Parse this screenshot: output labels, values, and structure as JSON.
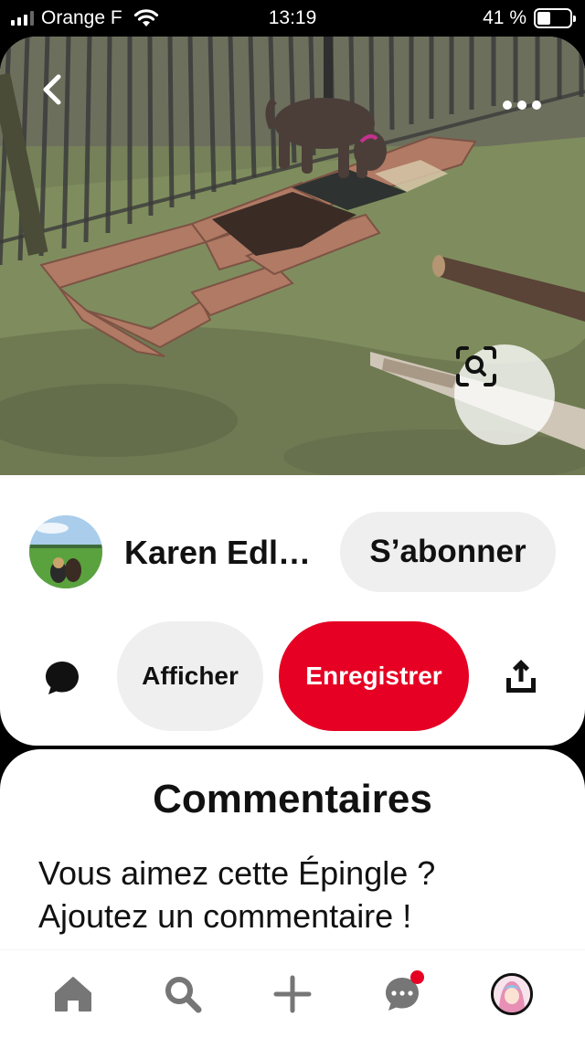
{
  "status_bar": {
    "carrier": "Orange F",
    "time": "13:19",
    "battery": "41 %",
    "battery_level": 0.41
  },
  "pin": {
    "image_alt": "Chien dans un jardin avec un enclos en briques",
    "icons": {
      "back": "chevron-left-icon",
      "more": "more-dots-icon",
      "lens": "visual-search-icon"
    }
  },
  "author": {
    "name": "Karen Edl…",
    "follow_label": "S’abonner"
  },
  "actions": {
    "view_label": "Afficher",
    "save_label": "Enregistrer",
    "save_color": "#e60023",
    "icons": {
      "comment": "comment-bubble-icon",
      "share": "share-upload-icon"
    }
  },
  "comments": {
    "title": "Commentaires",
    "prompt_line1": "Vous aimez cette Épingle ?",
    "prompt_line2": "Ajoutez un commentaire !"
  },
  "bottom_nav": {
    "items": [
      "home-icon",
      "search-icon",
      "plus-icon",
      "messages-icon",
      "profile-avatar"
    ],
    "messages_has_notification": true
  }
}
